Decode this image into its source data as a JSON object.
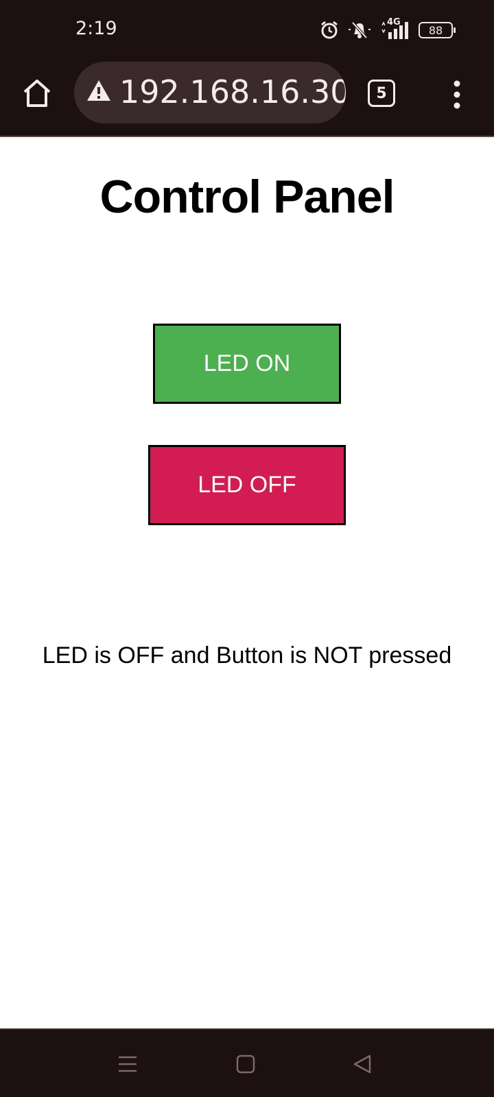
{
  "status_bar": {
    "time": "2:19",
    "network_label": "4G",
    "battery_level": "88"
  },
  "browser": {
    "url": "192.168.16.30",
    "tab_count": "5"
  },
  "page": {
    "title": "Control Panel",
    "led_on_label": "LED ON",
    "led_off_label": "LED OFF",
    "status_message": "LED is OFF and Button is NOT pressed"
  },
  "colors": {
    "led_on_button": "#4caf50",
    "led_off_button": "#d31c52",
    "chrome_background": "#1c1011"
  },
  "icons": {
    "status": [
      "alarm-icon",
      "bell-muted-icon",
      "signal-4g-icon",
      "battery-icon"
    ],
    "toolbar": [
      "home-icon",
      "warning-icon",
      "tabs-icon",
      "more-menu-icon"
    ],
    "navigation": [
      "recent-apps-icon",
      "home-nav-icon",
      "back-icon"
    ]
  }
}
